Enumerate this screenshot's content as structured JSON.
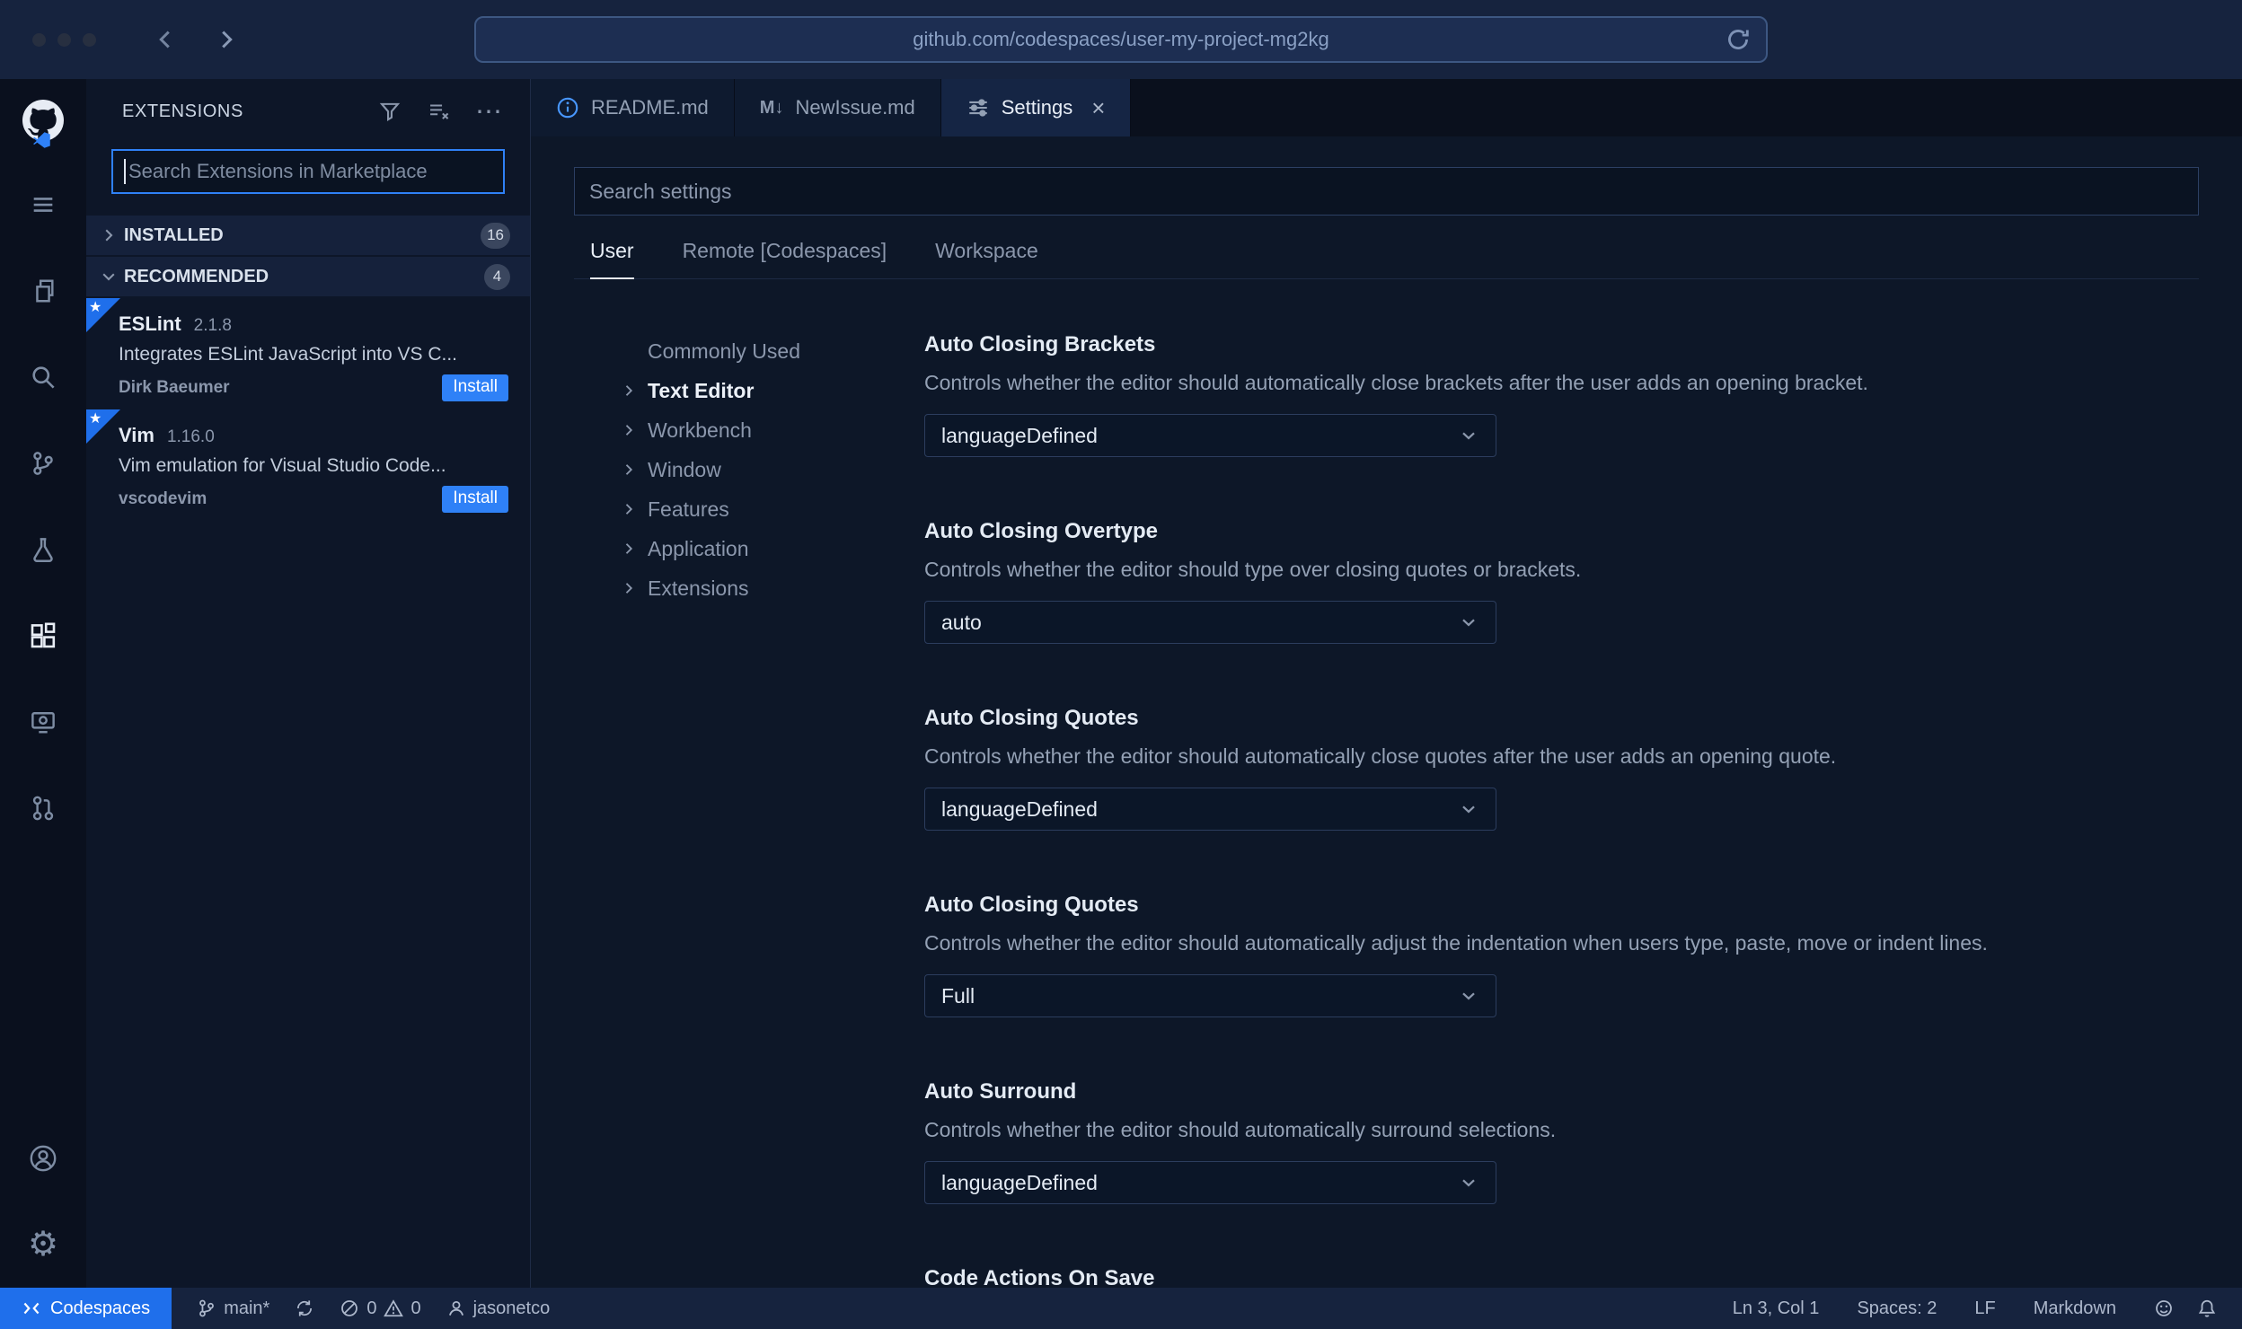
{
  "colors": {
    "accent": "#2f81f7",
    "chrome-bg": "#16233e",
    "url-bg": "#1d2e52",
    "url-border": "#3d5782",
    "url-text": "#8aa0c4",
    "activity-bg": "#0a101e",
    "sidebar-bg": "#0d1628",
    "editor-bg": "#0d1728",
    "tabbar-bg": "#0a101d",
    "tab-inactive": "#0e1a2f",
    "tab-active": "#152544",
    "section-bg": "#15213b",
    "input-bg": "#0a1322",
    "select-bg": "#0b1628",
    "select-border": "#2c3d5e",
    "remote-bg": "#1f6feb",
    "badge-bg": "#3a465e"
  },
  "browser": {
    "url": "github.com/codespaces/user-my-project-mg2kg"
  },
  "icons": {
    "more": "⋯",
    "close": "×",
    "markdown_tab": "M↓",
    "gear": "⚙",
    "star": "★"
  },
  "sidebar": {
    "title": "EXTENSIONS",
    "search_placeholder": "Search Extensions in Marketplace",
    "sections": [
      {
        "label": "INSTALLED",
        "count": "16"
      },
      {
        "label": "RECOMMENDED",
        "count": "4"
      }
    ],
    "extensions": [
      {
        "name": "ESLint",
        "version": "2.1.8",
        "description": "Integrates ESLint JavaScript into VS C...",
        "publisher": "Dirk Baeumer",
        "action": "Install"
      },
      {
        "name": "Vim",
        "version": "1.16.0",
        "description": "Vim emulation for Visual Studio Code...",
        "publisher": "vscodevim",
        "action": "Install"
      }
    ]
  },
  "tabs": {
    "readme": {
      "label": "README.md"
    },
    "newissue": {
      "label": "NewIssue.md"
    },
    "settings": {
      "label": "Settings"
    }
  },
  "settings": {
    "search_placeholder": "Search settings",
    "scopes": [
      {
        "label": "User"
      },
      {
        "label": "Remote [Codespaces]"
      },
      {
        "label": "Workspace"
      }
    ],
    "toc": [
      "Commonly Used",
      "Text Editor",
      "Workbench",
      "Window",
      "Features",
      "Application",
      "Extensions"
    ],
    "entries": [
      {
        "title": "Auto Closing Brackets",
        "description": "Controls whether the editor should automatically close brackets after the user adds an opening bracket.",
        "value": "languageDefined"
      },
      {
        "title": "Auto Closing Overtype",
        "description": "Controls whether the editor should type over closing quotes or brackets.",
        "value": "auto"
      },
      {
        "title": "Auto Closing Quotes",
        "description": "Controls whether the editor should automatically close quotes after the user adds an opening quote.",
        "value": "languageDefined"
      },
      {
        "title": "Auto Closing Quotes",
        "description": "Controls whether the editor should automatically adjust the indentation when users type, paste, move or indent lines.",
        "value": "Full"
      },
      {
        "title": "Auto Surround",
        "description": "Controls whether the editor should automatically surround selections.",
        "value": "languageDefined"
      }
    ],
    "next_entry_title": "Code Actions On Save"
  },
  "status_bar": {
    "remote_label": "Codespaces",
    "branch": "main*",
    "errors": "0",
    "warnings": "0",
    "user": "jasonetco",
    "line_col": "Ln 3, Col 1",
    "indent": "Spaces: 2",
    "eol": "LF",
    "language": "Markdown"
  }
}
